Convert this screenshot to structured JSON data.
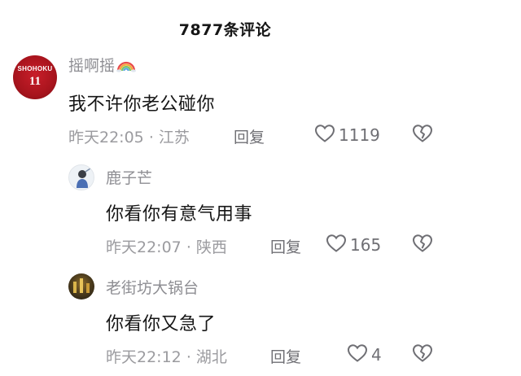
{
  "header": {
    "title": "7877条评论"
  },
  "comments": [
    {
      "username": "摇啊摇",
      "username_emoji": "rainbow-icon",
      "avatar": {
        "team": "SHOHOKU",
        "number": "11"
      },
      "text": "我不许你老公碰你",
      "time": "昨天22:05",
      "separator": "·",
      "location": "江苏",
      "reply_label": "回复",
      "likes": "1119",
      "like_icon": "heart-icon",
      "dislike_icon": "broken-heart-icon"
    },
    {
      "username": "鹿子芒",
      "text": "你看你有意气用事",
      "time": "昨天22:07",
      "separator": "·",
      "location": "陕西",
      "reply_label": "回复",
      "likes": "165",
      "like_icon": "heart-icon",
      "dislike_icon": "broken-heart-icon"
    },
    {
      "username": "老街坊大锅台",
      "text": "你看你又急了",
      "time": "昨天22:12",
      "separator": "·",
      "location": "湖北",
      "reply_label": "回复",
      "likes": "4",
      "like_icon": "heart-icon",
      "dislike_icon": "broken-heart-icon"
    }
  ]
}
